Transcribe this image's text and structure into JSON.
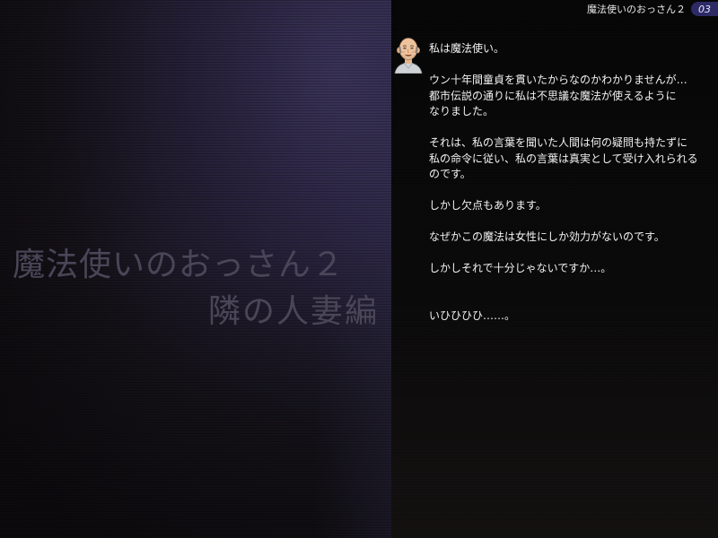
{
  "header": {
    "title": "魔法使いのおっさん２",
    "page_number": "03"
  },
  "cover": {
    "title": "魔法使いのおっさん２",
    "subtitle": "隣の人妻編"
  },
  "speaker": {
    "avatar_icon": "bald-old-man-avatar-icon"
  },
  "dialogue": {
    "lines": [
      "私は魔法使い。",
      "",
      "ウン十年間童貞を貫いたからなのかわかりませんが…",
      "都市伝説の通りに私は不思議な魔法が使えるように",
      "なりました。",
      "",
      "それは、私の言葉を聞いた人間は何の疑問も持たずに",
      "私の命令に従い、私の言葉は真実として受け入れられる",
      "のです。",
      "",
      "しかし欠点もあります。",
      "",
      "なぜかこの魔法は女性にしか効力がないのです。",
      "",
      "しかしそれで十分じゃないですか…。",
      "",
      "",
      "いひひひひ……。"
    ]
  },
  "colors": {
    "badge": "#2d2a66",
    "title_text": "#4a4658",
    "dialogue_text": "#f2f2f2"
  }
}
